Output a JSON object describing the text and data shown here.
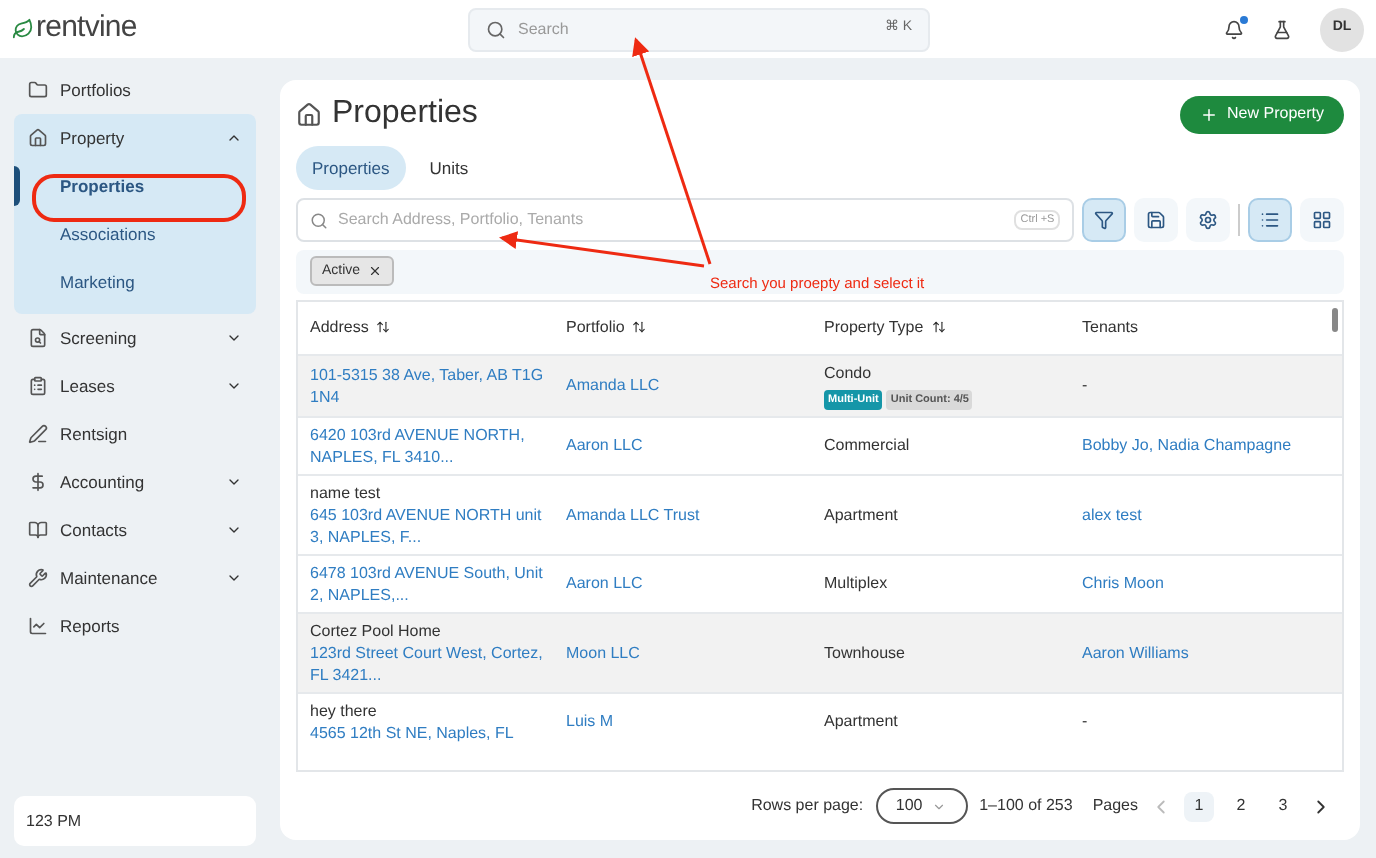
{
  "header": {
    "logo": "rentvine",
    "search": {
      "placeholder": "Search",
      "shortcut": "⌘ K"
    },
    "notification_unread": true,
    "avatar": "DL"
  },
  "sidebar": {
    "items": [
      {
        "label": "Portfolios",
        "kind": "link"
      },
      {
        "label": "Property",
        "kind": "group",
        "expanded": true,
        "children": [
          {
            "label": "Properties",
            "selected": true
          },
          {
            "label": "Associations",
            "selected": false
          },
          {
            "label": "Marketing",
            "selected": false
          }
        ]
      },
      {
        "label": "Screening",
        "kind": "group",
        "expanded": false
      },
      {
        "label": "Leases",
        "kind": "group",
        "expanded": false
      },
      {
        "label": "Rentsign",
        "kind": "link"
      },
      {
        "label": "Accounting",
        "kind": "group",
        "expanded": false
      },
      {
        "label": "Contacts",
        "kind": "group",
        "expanded": false
      },
      {
        "label": "Maintenance",
        "kind": "group",
        "expanded": false
      },
      {
        "label": "Reports",
        "kind": "link"
      }
    ],
    "footer": "123 PM"
  },
  "page": {
    "title": "Properties",
    "new_button": "New Property",
    "tabs": [
      {
        "label": "Properties",
        "selected": true
      },
      {
        "label": "Units",
        "selected": false
      }
    ],
    "search": {
      "placeholder": "Search Address, Portfolio, Tenants",
      "shortcut": "Ctrl +S"
    },
    "tools": [
      {
        "kind": "filter",
        "on": true
      },
      {
        "kind": "save",
        "on": false
      },
      {
        "kind": "settings",
        "on": false
      },
      {
        "kind": "list",
        "on": true
      },
      {
        "kind": "grid",
        "on": false
      }
    ],
    "filter_chips": [
      "Active"
    ],
    "table": {
      "columns": [
        {
          "label": "Address",
          "sortable": true
        },
        {
          "label": "Portfolio",
          "sortable": true
        },
        {
          "label": "Property Type",
          "sortable": true
        },
        {
          "label": "Tenants",
          "sortable": false
        }
      ],
      "rows": [
        {
          "highlighted": true,
          "address": "101-5315 38 Ave, Taber, AB T1G 1N4",
          "portfolio": "Amanda LLC",
          "type": "Condo",
          "badges": [
            {
              "label": "Multi-Unit",
              "kind": "type"
            },
            {
              "label": "Unit Count: 4/5",
              "kind": "count"
            }
          ],
          "tenants": {
            "text": "-",
            "link": false
          }
        },
        {
          "highlighted": false,
          "address": "6420 103rd AVENUE NORTH, NAPLES, FL 3410...",
          "portfolio": "Aaron LLC",
          "type": "Commercial",
          "tenants": {
            "text": "Bobby Jo, Nadia Champagne",
            "link": true
          }
        },
        {
          "highlighted": false,
          "name": "name test",
          "address": "645 103rd AVENUE NORTH unit 3, NAPLES, F...",
          "portfolio": "Amanda LLC Trust",
          "type": "Apartment",
          "tenants": {
            "text": "alex test",
            "link": true
          }
        },
        {
          "highlighted": false,
          "address": "6478 103rd AVENUE South, Unit 2, NAPLES,...",
          "portfolio": "Aaron LLC",
          "type": "Multiplex",
          "tenants": {
            "text": "Chris Moon",
            "link": true
          }
        },
        {
          "highlighted": true,
          "name": "Cortez Pool Home",
          "address": "123rd Street Court West, Cortez, FL 3421...",
          "portfolio": "Moon LLC",
          "type": "Townhouse",
          "tenants": {
            "text": "Aaron Williams",
            "link": true
          }
        },
        {
          "highlighted": false,
          "name": "hey there",
          "address": "4565 12th St NE, Naples, FL",
          "portfolio": "Luis M",
          "type": "Apartment",
          "tenants": {
            "text": "-",
            "link": false
          }
        }
      ]
    },
    "pagination": {
      "rows_label": "Rows per page:",
      "rows_value": "100",
      "range": "1–100 of 253",
      "pages_label": "Pages",
      "pages": [
        {
          "label": "1",
          "selected": true
        },
        {
          "label": "2",
          "selected": false
        },
        {
          "label": "3",
          "selected": false
        }
      ]
    }
  },
  "annotation": {
    "text": "Search you proepty and select it"
  }
}
